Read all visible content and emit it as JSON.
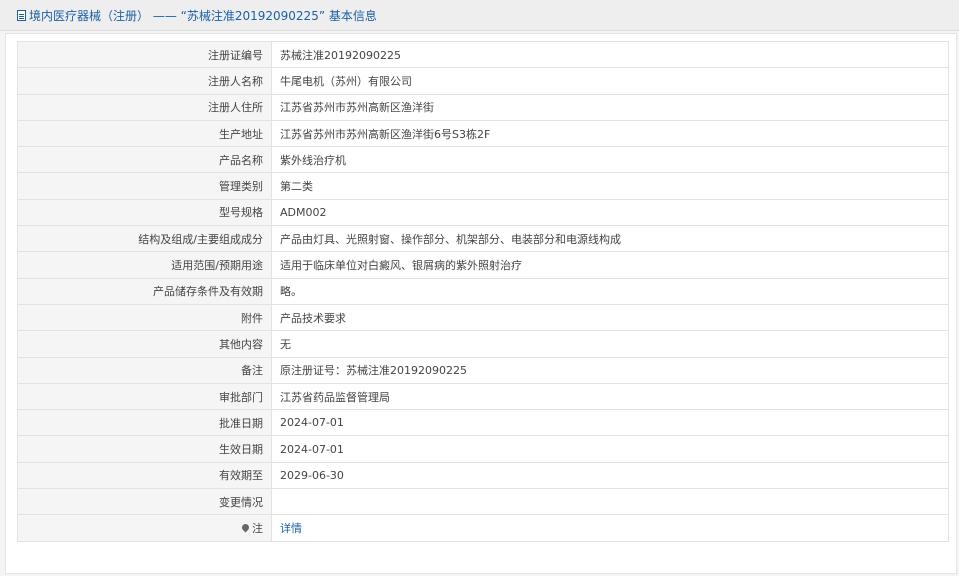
{
  "header": {
    "title": "境内医疗器械（注册） —— “苏械注准20192090225” 基本信息"
  },
  "rows": [
    {
      "label": "注册证编号",
      "value": "苏械注准20192090225"
    },
    {
      "label": "注册人名称",
      "value": "牛尾电机（苏州）有限公司"
    },
    {
      "label": "注册人住所",
      "value": "江苏省苏州市苏州高新区渔洋街"
    },
    {
      "label": "生产地址",
      "value": "江苏省苏州市苏州高新区渔洋街6号S3栋2F"
    },
    {
      "label": "产品名称",
      "value": "紫外线治疗机"
    },
    {
      "label": "管理类别",
      "value": "第二类"
    },
    {
      "label": "型号规格",
      "value": "ADM002"
    },
    {
      "label": "结构及组成/主要组成成分",
      "value": "产品由灯具、光照射窗、操作部分、机架部分、电装部分和电源线构成"
    },
    {
      "label": "适用范围/预期用途",
      "value": "适用于临床单位对白癜风、银屑病的紫外照射治疗"
    },
    {
      "label": "产品储存条件及有效期",
      "value": "略。"
    },
    {
      "label": "附件",
      "value": "产品技术要求"
    },
    {
      "label": "其他内容",
      "value": "无"
    },
    {
      "label": "备注",
      "value": "原注册证号：苏械注准20192090225"
    },
    {
      "label": "审批部门",
      "value": "江苏省药品监督管理局"
    },
    {
      "label": "批准日期",
      "value": "2024-07-01"
    },
    {
      "label": "生效日期",
      "value": "2024-07-01"
    },
    {
      "label": "有效期至",
      "value": "2029-06-30"
    },
    {
      "label": "变更情况",
      "value": ""
    }
  ],
  "note_row": {
    "label": "注",
    "icon": "pin-icon",
    "link_text": "详情"
  },
  "colors": {
    "link": "#1c5fa8",
    "label_bg": "#f5f5f5",
    "border": "#e2e2e2"
  }
}
